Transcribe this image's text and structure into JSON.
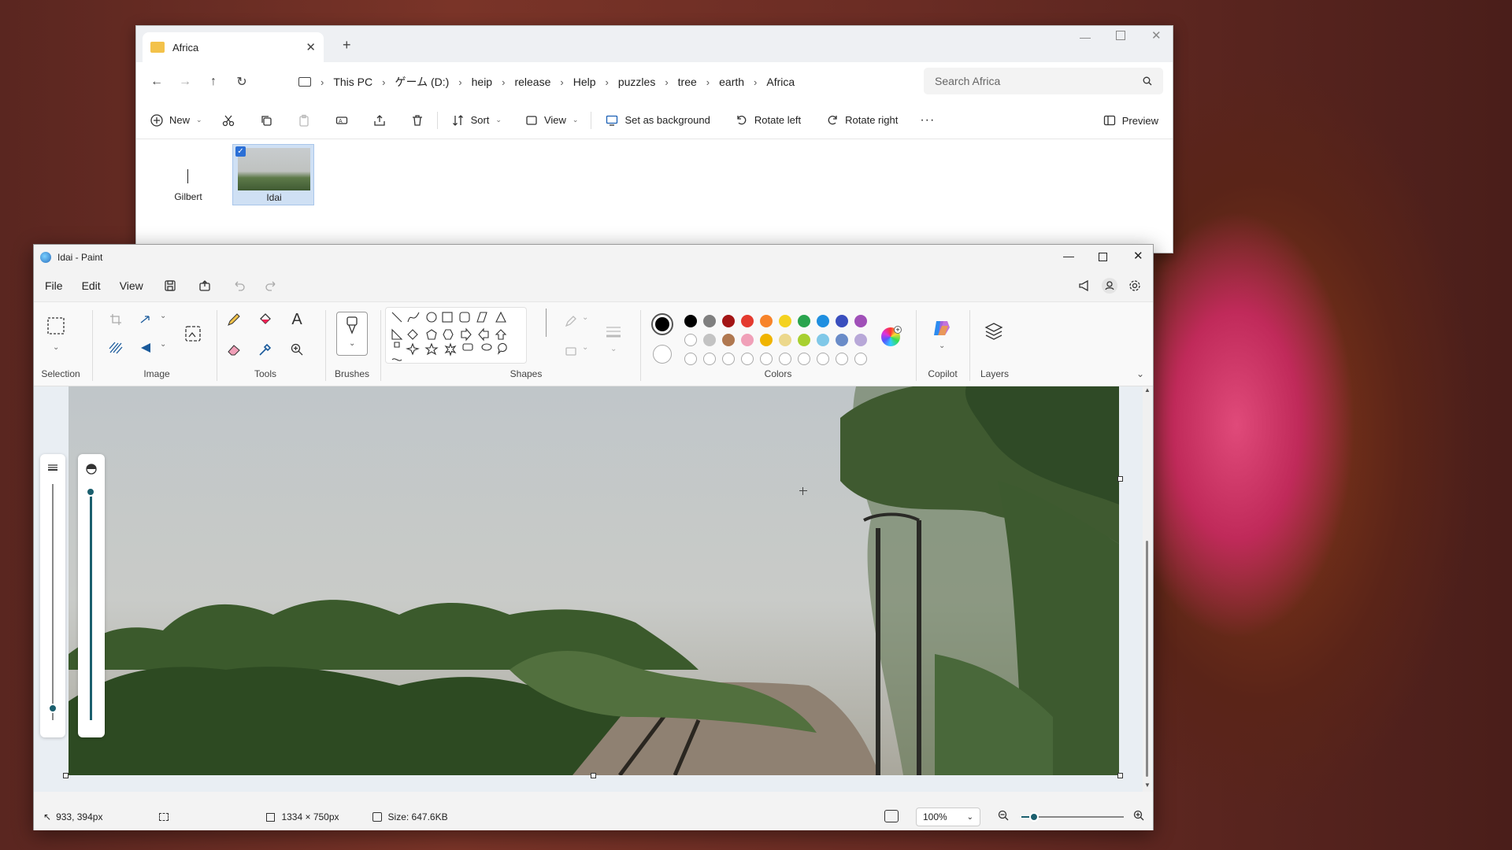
{
  "explorer": {
    "tab_title": "Africa",
    "breadcrumbs": [
      "This PC",
      "ゲーム (D:)",
      "heip",
      "release",
      "Help",
      "puzzles",
      "tree",
      "earth",
      "Africa"
    ],
    "search_placeholder": "Search Africa",
    "cmd": {
      "new": "New",
      "sort": "Sort",
      "view": "View",
      "set_bg": "Set as background",
      "rotate_left": "Rotate left",
      "rotate_right": "Rotate right",
      "preview": "Preview"
    },
    "items": [
      {
        "name": "Gilbert"
      },
      {
        "name": "Idai"
      }
    ]
  },
  "paint": {
    "title": "Idai - Paint",
    "menu": [
      "File",
      "Edit",
      "View"
    ],
    "groups": {
      "selection": "Selection",
      "image": "Image",
      "tools": "Tools",
      "brushes": "Brushes",
      "shapes": "Shapes",
      "colors": "Colors",
      "copilot": "Copilot",
      "layers": "Layers"
    },
    "palette_row1": [
      "#000000",
      "#7f7f7f",
      "#a31515",
      "#e43a2f",
      "#f7832a",
      "#f4d21f",
      "#2aa44e",
      "#1f8fe0",
      "#3a4fbe",
      "#a050b8"
    ],
    "palette_row2": [
      "#ffffff",
      "#c3c3c3",
      "#b07850",
      "#f0a0b8",
      "#f0b400",
      "#ecd88c",
      "#a8d030",
      "#80c8e8",
      "#6a8cc8",
      "#b8a8d8"
    ],
    "status": {
      "cursor": "933, 394px",
      "dimensions": "1334 × 750px",
      "size": "Size: 647.6KB",
      "zoom": "100%"
    },
    "zoom_fraction": 0.12,
    "brush_size_fraction": 0.05,
    "opacity_fraction": 1.0
  }
}
